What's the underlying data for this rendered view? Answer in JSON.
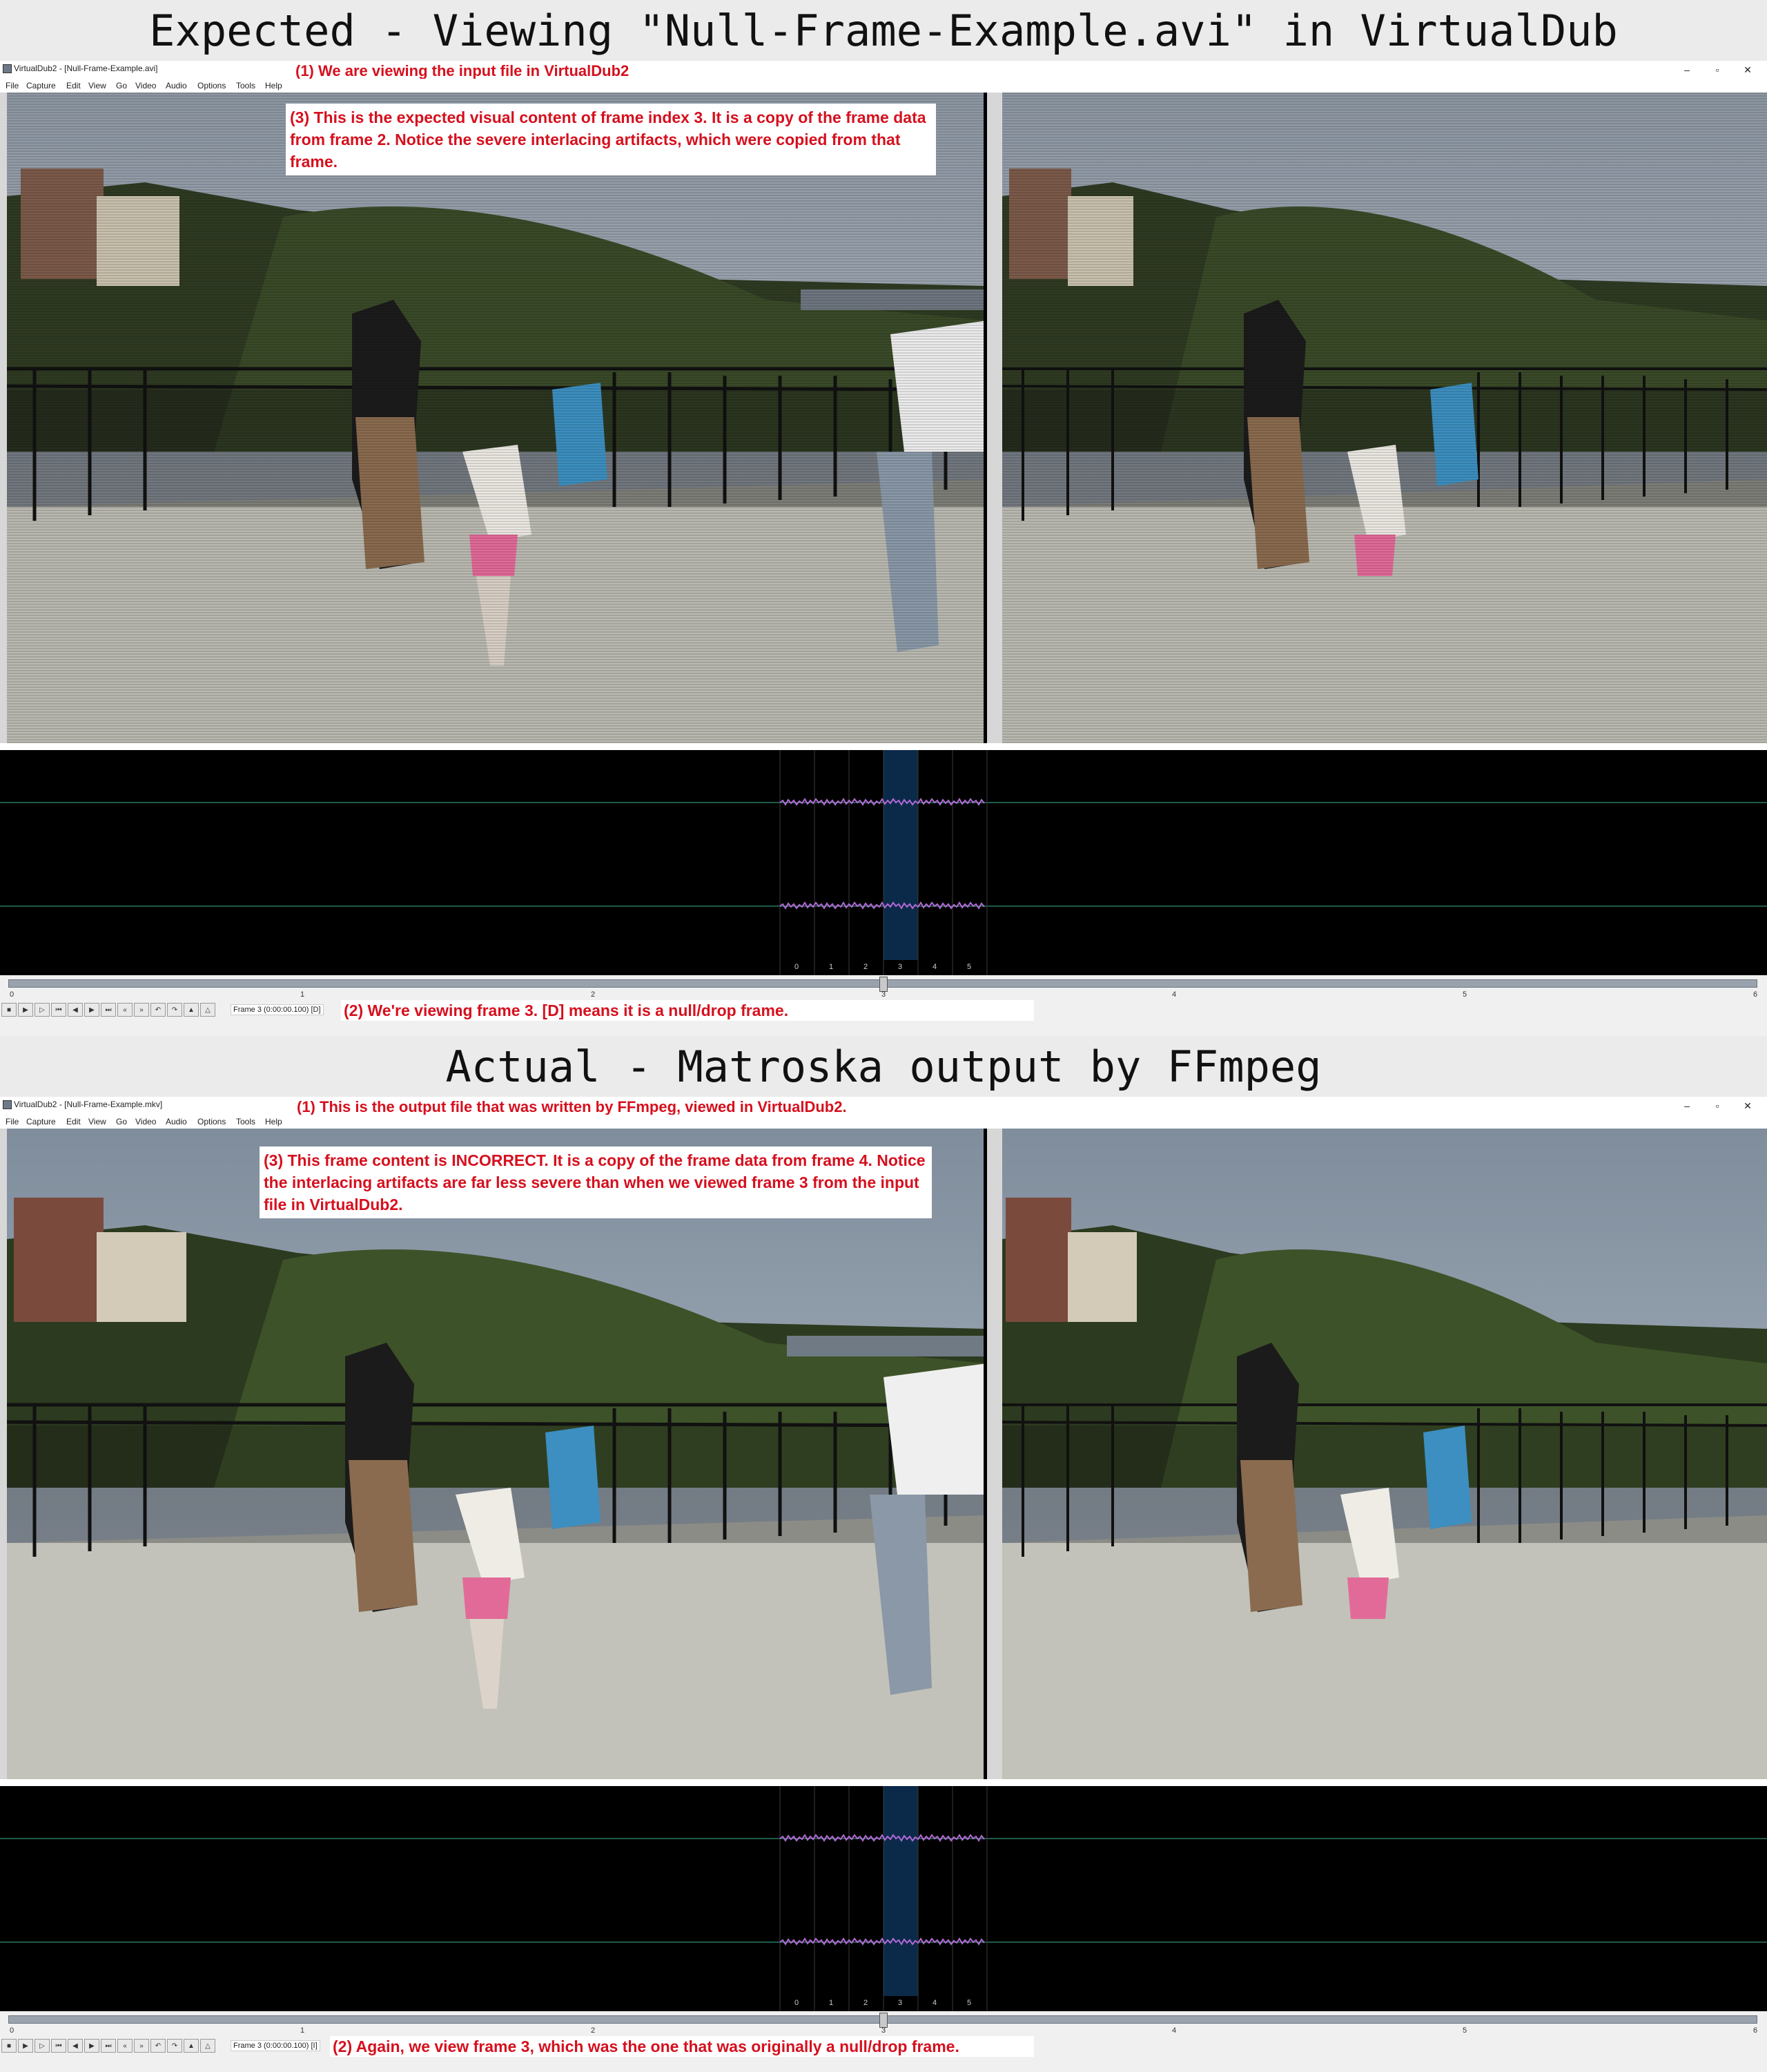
{
  "top": {
    "banner": "Expected - Viewing \"Null-Frame-Example.avi\" in VirtualDub",
    "window_title": "VirtualDub2 - [Null-Frame-Example.avi]",
    "note1": "(1) We are viewing the input file in VirtualDub2",
    "note3": "(3) This is the expected visual content of frame index 3.  It is a copy of the frame data from frame 2.  Notice the severe interlacing artifacts, which were copied from that frame.",
    "frame_status": "Frame 3 (0:00:00.100) [D]",
    "note2": "(2) We're viewing frame 3.  [D] means it is a null/drop frame."
  },
  "bottom": {
    "banner": "Actual - Matroska output by FFmpeg",
    "window_title": "VirtualDub2 - [Null-Frame-Example.mkv]",
    "note1": "(1) This is the output file that was written by FFmpeg, viewed in VirtualDub2.",
    "note3": "(3) This frame content is INCORRECT.  It is a copy of the frame data from frame 4.  Notice the interlacing artifacts are far less severe than when we viewed frame 3 from the input file in VirtualDub2.",
    "frame_status": "Frame 3 (0:00:00.100) [I]",
    "note2": "(2) Again, we view frame 3, which was the one that was originally a null/drop frame."
  },
  "menu": [
    "File",
    "Capture",
    "Edit",
    "View",
    "Go",
    "Video",
    "Audio",
    "Options",
    "Tools",
    "Help"
  ],
  "window_buttons": {
    "minimize": "–",
    "restore": "▫",
    "close": "✕"
  },
  "waveform_frame_labels": [
    "0",
    "1",
    "2",
    "3",
    "4",
    "5"
  ],
  "timeline_ticks": [
    "0",
    "1",
    "2",
    "3",
    "4",
    "5",
    "6"
  ],
  "current_frame": 3,
  "total_frames": 6,
  "colors": {
    "annotation": "#d6101e",
    "selected_frame": "#0b2a4a",
    "waveform": "#b36ad6",
    "banner_bg": "#ebebeb"
  },
  "icons": [
    "app-icon",
    "stop-icon",
    "play-input-icon",
    "play-output-icon",
    "start-icon",
    "prev-frame-icon",
    "next-frame-icon",
    "end-icon",
    "prev-key-icon",
    "next-key-icon",
    "scene-back-icon",
    "scene-fwd-icon",
    "mark-in-icon",
    "mark-out-icon"
  ]
}
